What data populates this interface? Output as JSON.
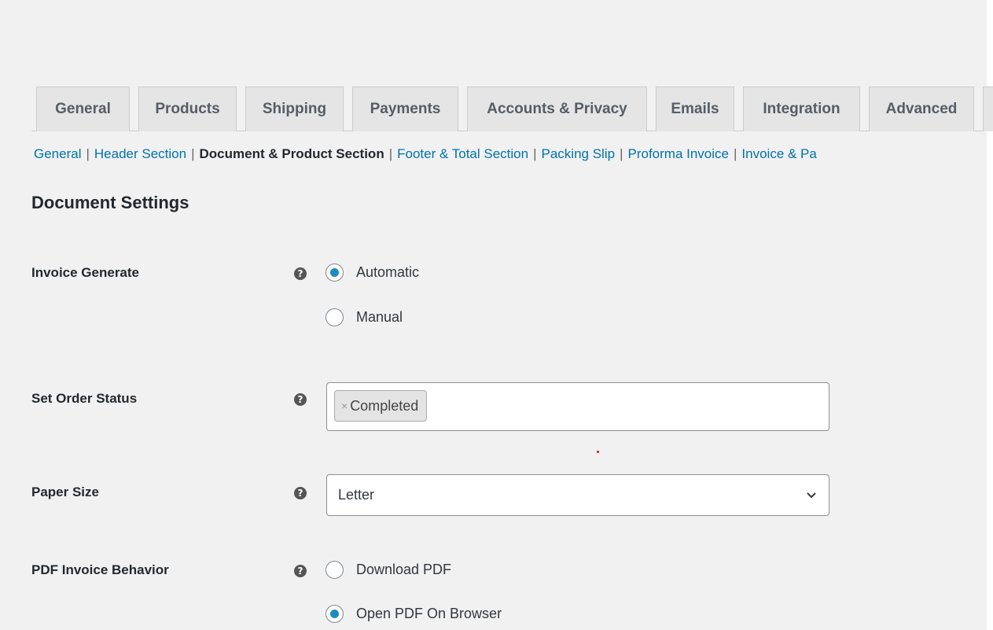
{
  "tabs": [
    "General",
    "Products",
    "Shipping",
    "Payments",
    "Accounts & Privacy",
    "Emails",
    "Integration",
    "Advanced"
  ],
  "subnav": [
    "General",
    "Header Section",
    "Document & Product Section",
    "Footer & Total Section",
    "Packing Slip",
    "Proforma Invoice",
    "Invoice & Pa"
  ],
  "subnav_current": "Document & Product Section",
  "section_title": "Document Settings",
  "help_glyph": "?",
  "invoice_generate": {
    "label": "Invoice Generate",
    "options": [
      "Automatic",
      "Manual"
    ],
    "selected": "Automatic"
  },
  "order_status": {
    "label": "Set Order Status",
    "tag_remove": "×",
    "tags": [
      "Completed"
    ]
  },
  "paper_size": {
    "label": "Paper Size",
    "value": "Letter"
  },
  "pdf_behavior": {
    "label": "PDF Invoice Behavior",
    "options": [
      "Download PDF",
      "Open PDF On Browser"
    ],
    "selected": "Open PDF On Browser"
  },
  "colors": {
    "link": "#0073aa",
    "radio_checked": "#1e8cbe",
    "background": "#f1f1f1"
  },
  "icons": {
    "help": "help-icon",
    "select": "chevron-down-icon"
  }
}
